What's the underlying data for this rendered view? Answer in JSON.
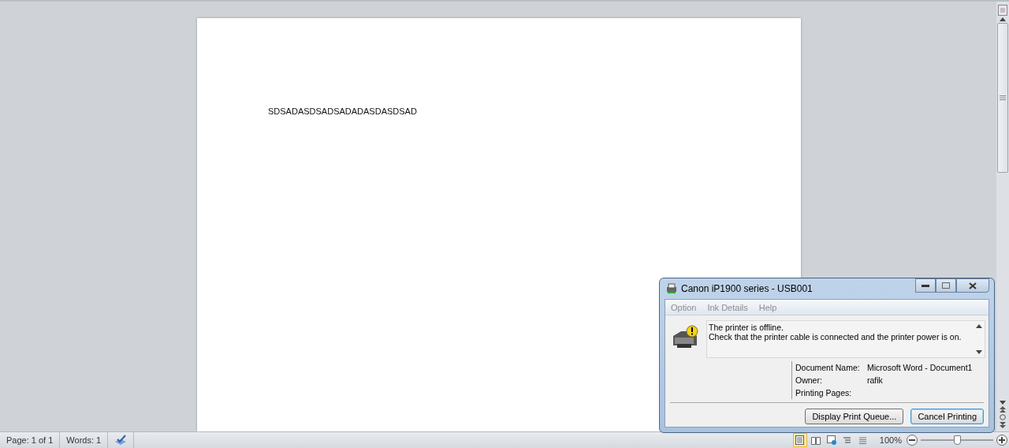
{
  "document": {
    "text": "SDSADASDSADSADADASDASDSAD"
  },
  "status_bar": {
    "page": "Page: 1 of 1",
    "words": "Words: 1",
    "views": [
      {
        "kind": "print",
        "selected": true
      },
      {
        "kind": "reading",
        "selected": false
      },
      {
        "kind": "web",
        "selected": false
      },
      {
        "kind": "outline",
        "selected": false
      },
      {
        "kind": "draft",
        "selected": false
      }
    ],
    "zoom": "100%",
    "zoom_level": {
      "level": 0.5
    }
  },
  "dialog": {
    "title": "Canon iP1900 series - USB001",
    "menu": [
      {
        "label": "Option",
        "disabled": true
      },
      {
        "label": "Ink Details",
        "disabled": true
      },
      {
        "label": "Help",
        "disabled": true
      }
    ],
    "message": [
      "The printer is offline.",
      "Check that the printer cable is connected and the printer power is on."
    ],
    "details": [
      {
        "label": "Document Name:",
        "value": "Microsoft Word - Document1"
      },
      {
        "label": "Owner:",
        "value": "rafik"
      },
      {
        "label": "Printing Pages:"
      }
    ],
    "buttons": [
      {
        "label": "Display Print Queue...",
        "selected": false
      },
      {
        "label": "Cancel Printing",
        "selected": true
      }
    ]
  }
}
